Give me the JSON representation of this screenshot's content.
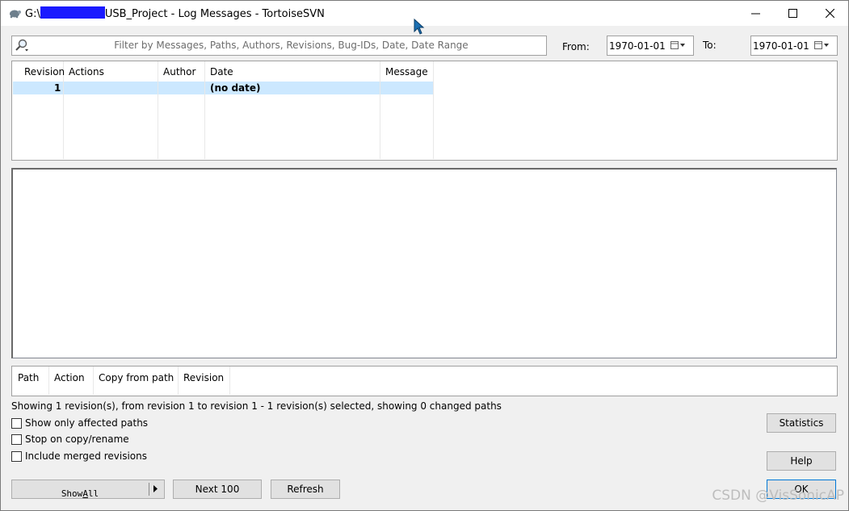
{
  "window": {
    "title_prefix": "G:\\",
    "title_suffix": "USB_Project - Log Messages - TortoiseSVN",
    "minimize_glyph": "—",
    "maximize_glyph": "☐",
    "close_glyph": "✕"
  },
  "filter": {
    "placeholder": "Filter by Messages, Paths, Authors, Revisions, Bug-IDs, Date, Date Range",
    "icon": "search-icon",
    "from_label": "From:",
    "from_value": "1970-01-01",
    "to_label": "To:",
    "to_value": "1970-01-01"
  },
  "log_list": {
    "columns": [
      "Revision",
      "Actions",
      "Author",
      "Date",
      "Message"
    ],
    "rows": [
      {
        "revision": "1",
        "actions": "",
        "author": "",
        "date": "(no date)",
        "message": ""
      }
    ]
  },
  "paths_list": {
    "columns": [
      "Path",
      "Action",
      "Copy from path",
      "Revision"
    ]
  },
  "status_text": "Showing 1 revision(s), from revision 1 to revision 1 - 1 revision(s) selected, showing 0 changed paths",
  "options": {
    "affected_paths": {
      "label": "Show only affected paths",
      "checked": false
    },
    "stop_on_copy": {
      "label": "Stop on copy/rename",
      "checked": false
    },
    "merged_revisions": {
      "label": "Include merged revisions",
      "checked": false
    }
  },
  "buttons": {
    "show_all_prefix": "Show ",
    "show_all_underlined": "A",
    "show_all_suffix": "ll",
    "next_100": "Next 100",
    "refresh": "Refresh",
    "statistics": "Statistics",
    "help": "Help",
    "ok": "OK"
  },
  "watermark": "CSDN @VisSonicAP",
  "colors": {
    "selection": "#cce8ff",
    "redaction": "#1a1aff",
    "ok_border": "#0078d7"
  }
}
